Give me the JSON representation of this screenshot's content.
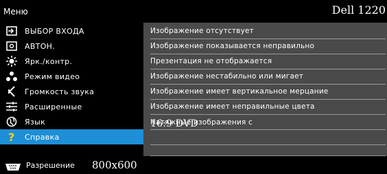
{
  "header": {
    "menu_title": "Меню",
    "model": "Dell 1220"
  },
  "sidebar": {
    "items": [
      {
        "label": "ВЫБОР ВХОДА",
        "icon": "input-source-icon"
      },
      {
        "label": "АВТОН.",
        "icon": "auto-adjust-icon"
      },
      {
        "label": "Ярк./контр.",
        "icon": "brightness-icon"
      },
      {
        "label": "Режим видео",
        "icon": "video-mode-icon"
      },
      {
        "label": "Громкость звука",
        "icon": "speaker-icon"
      },
      {
        "label": "Расширенные",
        "icon": "sliders-icon"
      },
      {
        "label": "Язык",
        "icon": "globe-icon"
      },
      {
        "label": "Справка",
        "icon": "question-icon",
        "selected": true
      }
    ]
  },
  "help": {
    "items": [
      "Изображение отсутствует",
      "Изображение показывается неправильно",
      "Презентация не отображается",
      "Изображение нестабильно или мигает",
      "Изображение имеет вертикальное мерцание",
      "Изображение имеет неправильные цвета",
      "Натяжные изображения с ",
      "",
      ""
    ],
    "aspect_text": "16:9 DVD"
  },
  "footer": {
    "resolution_label": "Разрешение",
    "resolution_value": "800x600",
    "icon": "display-connector-icon"
  },
  "colors": {
    "accent": "#1e8fd6",
    "panel": "#4a4a4a",
    "background": "#000000"
  }
}
